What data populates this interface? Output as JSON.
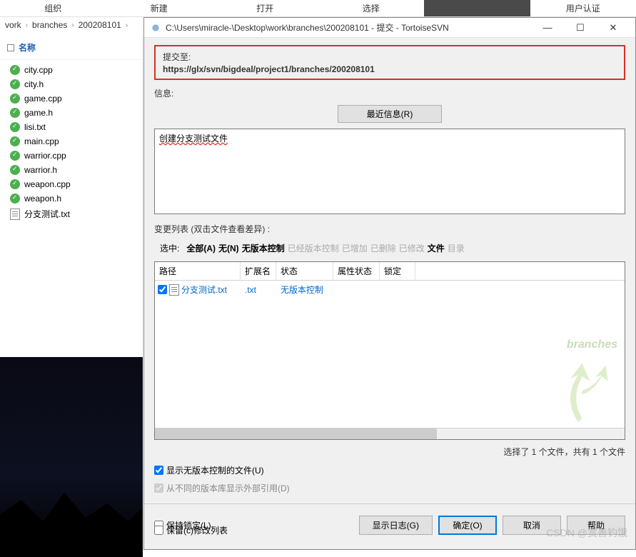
{
  "bg_toolbar": {
    "items": [
      "组织",
      "新建",
      "打开",
      "选择",
      "",
      "用户认证"
    ]
  },
  "breadcrumb": {
    "items": [
      "vork",
      "branches",
      "200208101"
    ]
  },
  "left": {
    "header": "名称",
    "files": [
      {
        "name": "city.cpp",
        "kind": "ok"
      },
      {
        "name": "city.h",
        "kind": "ok"
      },
      {
        "name": "game.cpp",
        "kind": "ok"
      },
      {
        "name": "game.h",
        "kind": "ok"
      },
      {
        "name": "lisi.txt",
        "kind": "ok"
      },
      {
        "name": "main.cpp",
        "kind": "ok"
      },
      {
        "name": "warrior.cpp",
        "kind": "ok"
      },
      {
        "name": "warrior.h",
        "kind": "ok"
      },
      {
        "name": "weapon.cpp",
        "kind": "ok"
      },
      {
        "name": "weapon.h",
        "kind": "ok"
      },
      {
        "name": "分支测试.txt",
        "kind": "txt"
      }
    ]
  },
  "dialog": {
    "title": "C:\\Users\\miracle-\\Desktop\\work\\branches\\200208101 - 提交 - TortoiseSVN",
    "commit_to_label": "提交至:",
    "commit_url": "https://glx/svn/bigdeal/project1/branches/200208101",
    "info_label": "信息:",
    "recent_btn": "最近信息(R)",
    "message": "创建分支测试文件",
    "changes_header": "变更列表 (双击文件查看差异) :",
    "filter": {
      "select_label": "选中:",
      "all": "全部(A)",
      "none": "无(N)",
      "unversioned": "无版本控制",
      "versioned": "已经版本控制",
      "added": "已增加",
      "deleted": "已删除",
      "modified": "已修改",
      "files": "文件",
      "dirs": "目录"
    },
    "table": {
      "cols": {
        "path": "路径",
        "ext": "扩展名",
        "status": "状态",
        "prop": "属性状态",
        "lock": "锁定"
      },
      "rows": [
        {
          "checked": true,
          "path": "分支测试.txt",
          "ext": ".txt",
          "status": "无版本控制",
          "prop": "",
          "lock": ""
        }
      ]
    },
    "branch_wm": "branches",
    "summary": "选择了 1 个文件，共有 1 个文件",
    "chk_unversioned": "显示无版本控制的文件(U)",
    "chk_externals": "从不同的版本库显示外部引用(D)",
    "chk_keeplock": "保持锁定(L)",
    "chk_keepcl": "保留(c)修改列表",
    "btn_log": "显示日志(G)",
    "btn_ok": "确定(O)",
    "btn_cancel": "取消",
    "btn_help": "帮助"
  },
  "csdn_wm": "CSDN @赏善钓饿"
}
